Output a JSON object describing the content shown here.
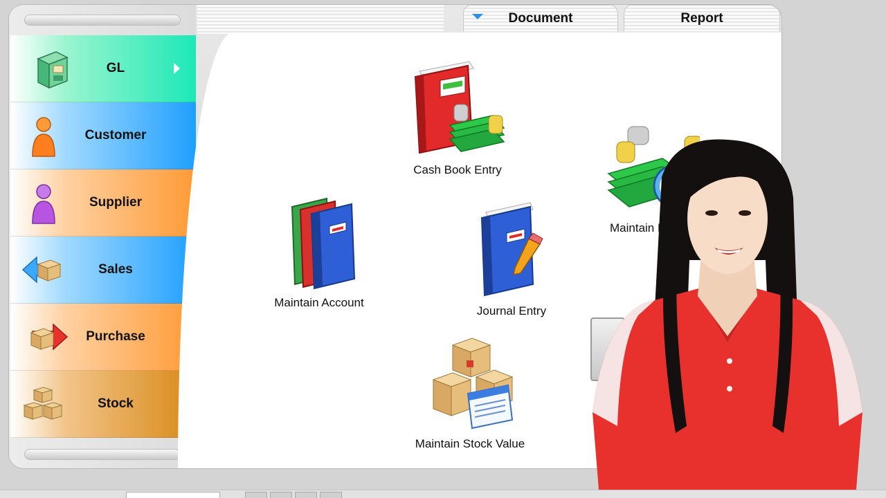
{
  "sidebar": {
    "items": [
      {
        "label": "GL",
        "icon": "file-cabinet-icon",
        "active": true
      },
      {
        "label": "Customer",
        "icon": "customer-person-icon"
      },
      {
        "label": "Supplier",
        "icon": "supplier-person-icon"
      },
      {
        "label": "Sales",
        "icon": "sales-box-icon"
      },
      {
        "label": "Purchase",
        "icon": "purchase-box-icon"
      },
      {
        "label": "Stock",
        "icon": "stock-boxes-icon"
      }
    ]
  },
  "tabs": [
    {
      "label": "Document",
      "active": true
    },
    {
      "label": "Report"
    }
  ],
  "modules": {
    "cash_book": "Cash Book Entry",
    "maintain_account": "Maintain Account",
    "journal_entry": "Journal Entry",
    "maintain_budget": "Maintain Bu",
    "maintain_stock_value": "Maintain Stock Value"
  },
  "colors": {
    "gl": "#1de8b7",
    "customer": "#1f9fff",
    "supplier": "#ff9a36",
    "stock": "#d88916",
    "shirt": "#e8302c"
  }
}
